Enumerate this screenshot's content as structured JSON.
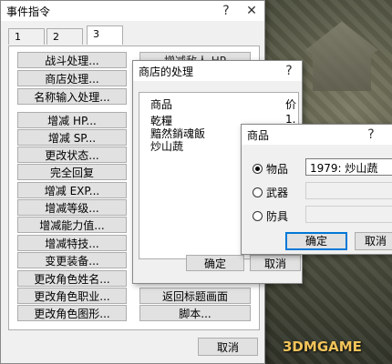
{
  "main": {
    "title": "事件指令",
    "tabs": [
      "1",
      "2",
      "3"
    ],
    "left_buttons": [
      "战斗处理...",
      "商店处理...",
      "名称输入处理...",
      "增减 HP...",
      "增减 SP...",
      "更改状态...",
      "完全回复",
      "增减 EXP...",
      "增减等级...",
      "增减能力值...",
      "增减特技...",
      "变更装备...",
      "更改角色姓名...",
      "更改角色职业...",
      "更改角色图形..."
    ],
    "right_buttons": [
      "增减敌人 HP",
      "返回标题画面",
      "脚本..."
    ],
    "cancel": "取消"
  },
  "shop": {
    "title": "商店的处理",
    "col_item": "商品",
    "col_price": "价",
    "items": [
      "乾糧",
      "黯然銷魂飯",
      "炒山蔬"
    ],
    "prices": [
      "1.",
      "1."
    ],
    "ok": "确定",
    "cancel": "取消"
  },
  "goods": {
    "title": "商品",
    "options": [
      {
        "label": "物品",
        "value": "1979: 炒山蔬",
        "checked": true
      },
      {
        "label": "武器",
        "value": "",
        "checked": false
      },
      {
        "label": "防具",
        "value": "",
        "checked": false
      }
    ],
    "ok": "确定",
    "cancel": "取消"
  },
  "watermark": {
    "brand": "3DMGAME"
  }
}
